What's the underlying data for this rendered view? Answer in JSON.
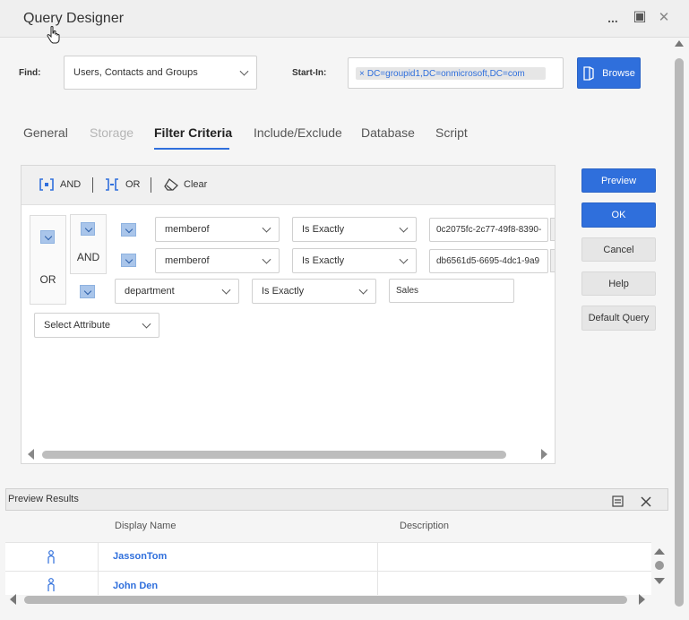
{
  "window": {
    "title": "Query Designer"
  },
  "titlebar": {
    "more": "...",
    "maximize": "▣",
    "close": "✕"
  },
  "find": {
    "label": "Find:",
    "value": "Users, Contacts and Groups"
  },
  "start_in": {
    "label": "Start-In:",
    "tag_remove": "×",
    "value": "DC=groupid1,DC=onmicrosoft,DC=com"
  },
  "browse": {
    "label": "Browse"
  },
  "tabs": [
    {
      "label": "General"
    },
    {
      "label": "Storage"
    },
    {
      "label": "Filter Criteria"
    },
    {
      "label": "Include/Exclude"
    },
    {
      "label": "Database"
    },
    {
      "label": "Script"
    }
  ],
  "toolbar": {
    "and_label": "AND",
    "or_label": "OR",
    "clear_label": "Clear"
  },
  "groups": {
    "outer": "OR",
    "inner": "AND"
  },
  "rules": [
    {
      "attribute": "memberof",
      "operator": "Is Exactly",
      "value": "0c2075fc-2c77-49f8-8390-"
    },
    {
      "attribute": "memberof",
      "operator": "Is Exactly",
      "value": "db6561d5-6695-4dc1-9a9"
    },
    {
      "attribute": "department",
      "operator": "Is Exactly",
      "value": "Sales"
    }
  ],
  "select_attribute": "Select Attribute",
  "side_buttons": {
    "preview": "Preview",
    "ok": "OK",
    "cancel": "Cancel",
    "help": "Help",
    "default_query": "Default Query"
  },
  "preview_results": {
    "title": "Preview Results",
    "columns": [
      "Display Name",
      "Description"
    ],
    "rows": [
      {
        "name": "JassonTom",
        "description": ""
      },
      {
        "name": "John Den",
        "description": ""
      }
    ]
  },
  "colors": {
    "accent": "#2f6fdc",
    "mini_dropdown": "#a9c5ea"
  }
}
